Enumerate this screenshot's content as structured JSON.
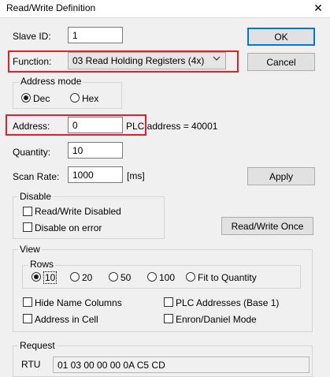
{
  "window": {
    "title": "Read/Write Definition",
    "close_glyph": "✕"
  },
  "slave_id": {
    "label": "Slave ID:",
    "value": "1"
  },
  "function": {
    "label": "Function:",
    "value": "03 Read Holding Registers (4x)"
  },
  "address_mode": {
    "label": "Address mode",
    "options": [
      "Dec",
      "Hex"
    ],
    "selected": "Dec"
  },
  "address": {
    "label": "Address:",
    "value": "0",
    "plc_text": "PLC address = 40001"
  },
  "quantity": {
    "label": "Quantity:",
    "value": "10"
  },
  "scan_rate": {
    "label": "Scan Rate:",
    "value": "1000",
    "unit": "[ms]"
  },
  "buttons": {
    "ok": "OK",
    "cancel": "Cancel",
    "apply": "Apply",
    "read_write_once": "Read/Write Once"
  },
  "disable": {
    "label": "Disable",
    "read_write_disabled": "Read/Write Disabled",
    "disable_on_error": "Disable on error"
  },
  "view": {
    "label": "View",
    "rows_label": "Rows",
    "rows_options": [
      "10",
      "20",
      "50",
      "100",
      "Fit to Quantity"
    ],
    "rows_selected": "10",
    "hide_name_columns": "Hide Name Columns",
    "address_in_cell": "Address in Cell",
    "plc_addresses": "PLC Addresses (Base 1)",
    "enron_daniel": "Enron/Daniel Mode"
  },
  "request": {
    "label": "Request",
    "rtu_label": "RTU",
    "rtu_value": "01 03 00 00 00 0A C5 CD"
  },
  "colors": {
    "highlight_border": "#e0202e",
    "default_button_border": "#0078d7"
  }
}
